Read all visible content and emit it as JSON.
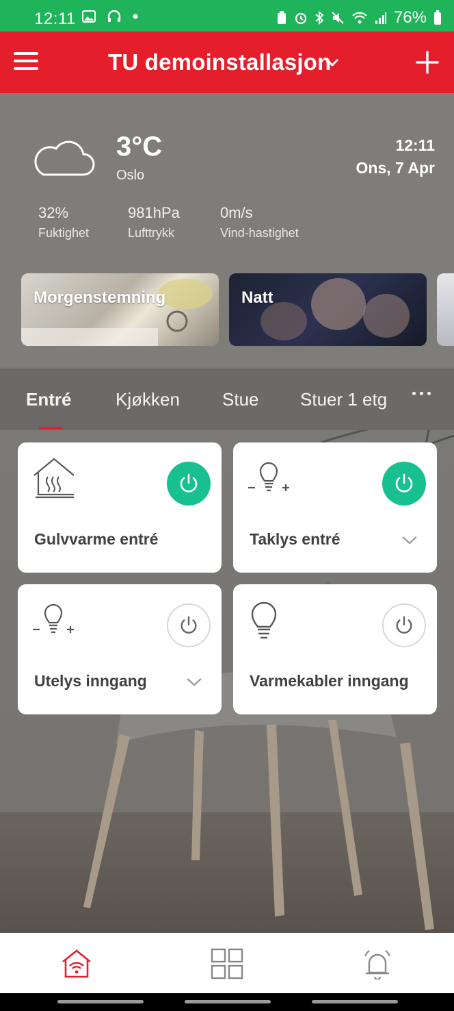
{
  "status_bar": {
    "time": "12:11",
    "battery": "76%"
  },
  "app_bar": {
    "title": "TU demoinstallasjon"
  },
  "weather": {
    "temperature": "3°C",
    "city": "Oslo",
    "time": "12:11",
    "date": "Ons, 7 Apr",
    "stats": [
      {
        "value": "32%",
        "label": "Fuktighet"
      },
      {
        "value": "981hPa",
        "label": "Lufttrykk"
      },
      {
        "value": "0m/s",
        "label": "Vind-hastighet"
      }
    ]
  },
  "scenes": [
    {
      "label": "Morgenstemning"
    },
    {
      "label": "Natt"
    }
  ],
  "tabs": [
    {
      "label": "Entré",
      "active": true
    },
    {
      "label": "Kjøkken"
    },
    {
      "label": "Stue"
    },
    {
      "label": "Stuer 1 etg"
    }
  ],
  "devices": [
    {
      "label": "Gulvvarme entré",
      "icon": "floor-heating-icon",
      "power": "on"
    },
    {
      "label": "Taklys entré",
      "icon": "dimmer-bulb-icon",
      "power": "on"
    },
    {
      "label": "Utelys inngang",
      "icon": "dimmer-bulb-icon",
      "power": "off"
    },
    {
      "label": "Varmekabler inngang",
      "icon": "bulb-icon",
      "power": "off"
    }
  ],
  "colors": {
    "status_bar": "#1fb35a",
    "app_bar": "#e41e2b",
    "power_on": "#17c08e"
  },
  "bottom_nav": [
    {
      "icon": "home-wifi-icon",
      "active": true
    },
    {
      "icon": "grid-icon"
    },
    {
      "icon": "alarm-bell-icon"
    }
  ]
}
